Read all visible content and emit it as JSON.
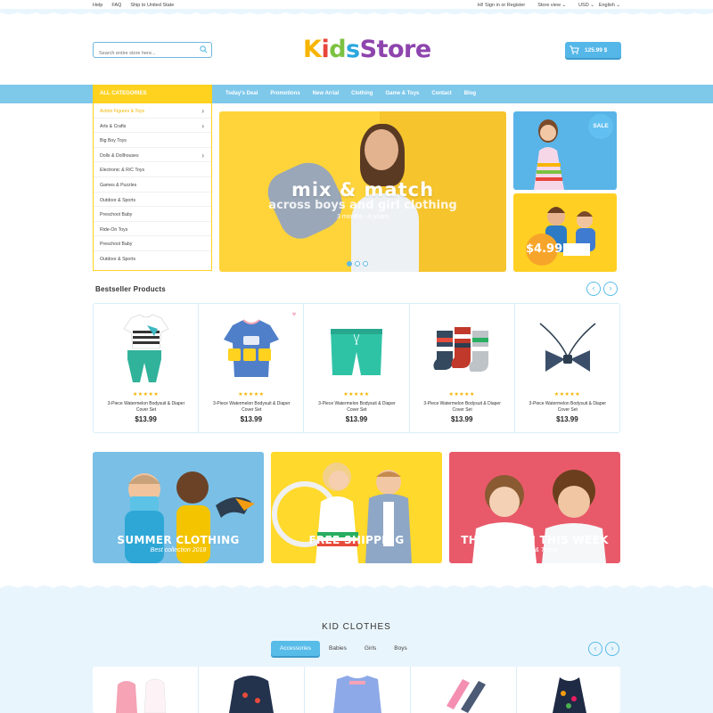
{
  "topbar": {
    "links": [
      "Help",
      "FAQ",
      "Ship to United State"
    ],
    "signin": "Hi! Sign in or Register",
    "store_view": "Store view ⌄",
    "currency": "USD ⌄",
    "language": "English ⌄"
  },
  "header": {
    "search_placeholder": "Search entire store here...",
    "logo_letters": [
      "K",
      "i",
      "d",
      "s",
      "S",
      "t",
      "o",
      "r",
      "e"
    ],
    "cart_total": "125.99 $"
  },
  "nav": {
    "all_categories": "ALL CATEGORIES",
    "links": [
      "Today's Deal",
      "Promotions",
      "New Arrial",
      "Clothing",
      "Game & Toys",
      "Contact",
      "Blog"
    ]
  },
  "categories": [
    {
      "label": "Action Figures & Toys",
      "arrow": "›"
    },
    {
      "label": "Arts & Crafts",
      "arrow": "›"
    },
    {
      "label": "Big Boy Toys",
      "arrow": ""
    },
    {
      "label": "Dolls & Dollhouses",
      "arrow": "›"
    },
    {
      "label": "Electronic & R/C Toys",
      "arrow": ""
    },
    {
      "label": "Games & Puzzles",
      "arrow": ""
    },
    {
      "label": "Outdoor & Sports",
      "arrow": ""
    },
    {
      "label": "Preschool Baby",
      "arrow": ""
    },
    {
      "label": "Ride-On Toys",
      "arrow": ""
    },
    {
      "label": "Preschool Baby",
      "arrow": ""
    },
    {
      "label": "Outdoor & Sports",
      "arrow": ""
    }
  ],
  "hero": {
    "title": "mix & match",
    "subtitle": "across boys and girl clothing",
    "age": "3 months - 6 years",
    "sale_badge": "SALE",
    "price_badge": "$4.99"
  },
  "bestseller": {
    "title": "Bestseller Products",
    "stars": "★★★★★",
    "products": [
      {
        "name": "3-Piece Watermelon Bodysuit & Diaper Cover Set",
        "price": "$13.99"
      },
      {
        "name": "3-Piece Watermelon Bodysuit & Diaper Cover Set",
        "price": "$13.99"
      },
      {
        "name": "3-Piece Watermelon Bodysuit & Diaper Cover Set",
        "price": "$13.99"
      },
      {
        "name": "3-Piece Watermelon Bodysuit & Diaper Cover Set",
        "price": "$13.99"
      },
      {
        "name": "3-Piece Watermelon Bodysuit & Diaper Cover Set",
        "price": "$13.99"
      }
    ]
  },
  "banners": [
    {
      "title": "SUMMER CLOTHING",
      "subtitle": "Best collection 2018"
    },
    {
      "title": "FREE SHIPPING",
      "subtitle": ""
    },
    {
      "title": "THE NEW IN THIS WEEK",
      "subtitle": "for Kids & Teens"
    }
  ],
  "kid_clothes": {
    "title": "KID CLOTHES",
    "tabs": [
      "Accessories",
      "Babies",
      "Girls",
      "Boys"
    ]
  },
  "colors": {
    "accent_blue": "#58bce9",
    "accent_yellow": "#ffd21f",
    "logo": [
      "#f7b500",
      "#e8453c",
      "#7cc242",
      "#2ba6de",
      "#8e44ad",
      "#8e44ad",
      "#8e44ad",
      "#8e44ad",
      "#8e44ad"
    ]
  }
}
